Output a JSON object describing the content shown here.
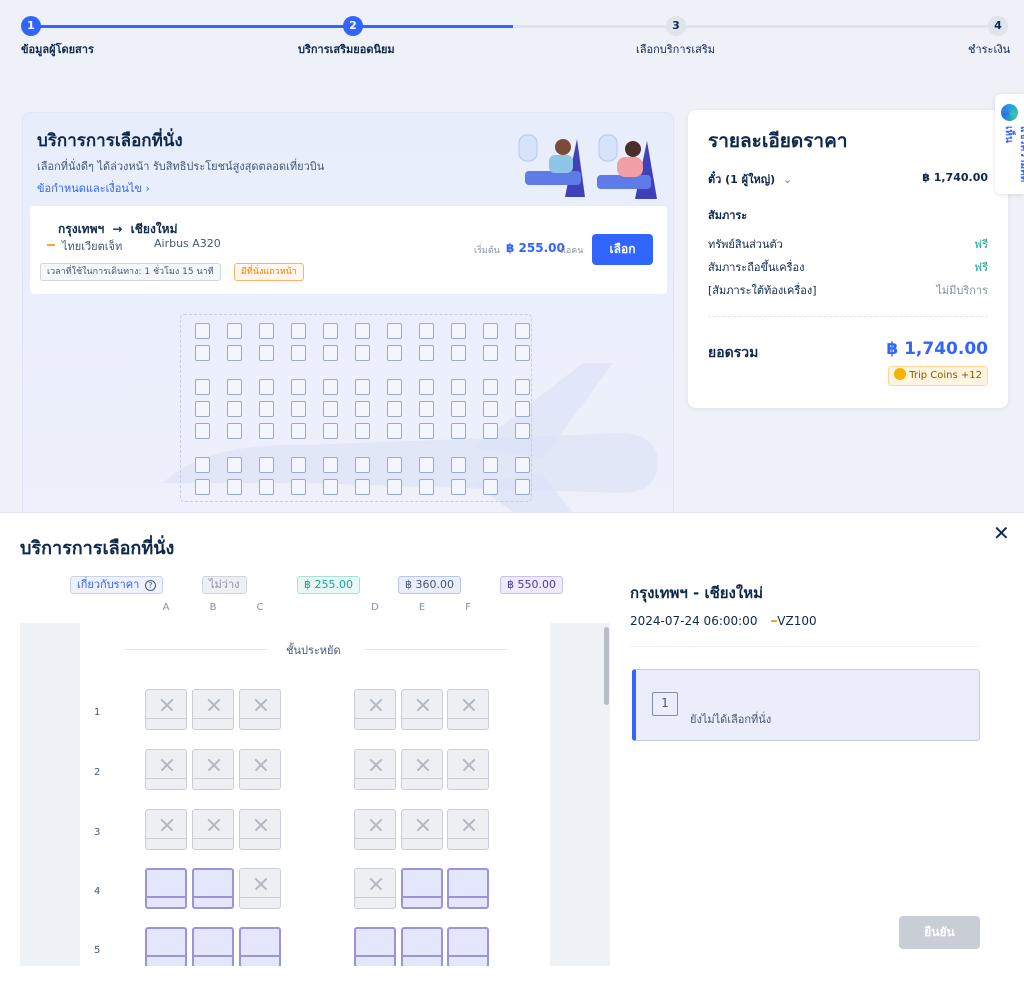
{
  "steps": [
    {
      "num": "1",
      "label": "ข้อมูลผู้โดยสาร"
    },
    {
      "num": "2",
      "label": "บริการเสริมยอดนิยม"
    },
    {
      "num": "3",
      "label": "เลือกบริการเสริม"
    },
    {
      "num": "4",
      "label": "ชำระเงิน"
    }
  ],
  "seat_card": {
    "title": "บริการการเลือกที่นั่ง",
    "subtitle": "เลือกที่นั่งดีๆ ได้ล่วงหน้า รับสิทธิประโยชน์สูงสุดตลอดเที่ยวบิน",
    "terms_link": "ข้อกำหนดและเงื่อนไข",
    "route_from": "กรุงเทพฯ",
    "route_to": "เชียงใหม่",
    "airline": "ไทยเวียตเจ็ท",
    "aircraft": "Airbus A320",
    "duration": "เวลาที่ใช้ในการเดินทาง: 1 ชั่วโมง 15 นาที",
    "front_row_badge": "มีที่นั่งแถวหน้า",
    "price_prefix": "เริ่มต้น",
    "price": "฿ 255.00",
    "price_suffix": "ต่อคน",
    "select_button": "เลือก"
  },
  "price_details": {
    "title": "รายละเอียดราคา",
    "ticket_label": "ตั๋ว (1 ผู้ใหญ่)",
    "ticket_price": "฿ 1,740.00",
    "baggage_heading": "สัมภาระ",
    "baggage_items": [
      {
        "label": "ทรัพย์สินส่วนตัว",
        "value": "ฟรี"
      },
      {
        "label": "สัมภาระถือขึ้นเครื่อง",
        "value": "ฟรี"
      },
      {
        "label": "[สัมภาระใต้ท้องเครื่อง]",
        "value": "ไม่มีบริการ"
      }
    ],
    "total_label": "ยอดรวม",
    "total_value": "฿ 1,740.00",
    "coins": "Trip Coins +12"
  },
  "side_tab": {
    "label": "แชร์ความคิดเห็น"
  },
  "modal": {
    "title": "บริการการเลือกที่นั่ง",
    "legend": {
      "about_price": "เกี่ยวกับราคา",
      "unavailable": "ไม่ว่าง",
      "price_green": "฿ 255.00",
      "price_blue": "฿ 360.00",
      "price_purple": "฿ 550.00"
    },
    "columns": [
      "A",
      "B",
      "C",
      "D",
      "E",
      "F"
    ],
    "cabin_label": "ชั้นประหยัด",
    "rows": [
      {
        "num": "1",
        "seats": [
          "x",
          "x",
          "x",
          "x",
          "x",
          "x"
        ]
      },
      {
        "num": "2",
        "seats": [
          "x",
          "x",
          "x",
          "x",
          "x",
          "x"
        ]
      },
      {
        "num": "3",
        "seats": [
          "x",
          "x",
          "x",
          "x",
          "x",
          "x"
        ]
      },
      {
        "num": "4",
        "seats": [
          "p",
          "p",
          "x",
          "x",
          "p",
          "p"
        ]
      },
      {
        "num": "5",
        "seats": [
          "p",
          "p",
          "p",
          "p",
          "p",
          "p"
        ]
      }
    ],
    "flight_route": "กรุงเทพฯ - เชียงใหม่",
    "flight_datetime": "2024-07-24 06:00:00",
    "flight_number": "VZ100",
    "passenger_num": "1",
    "no_seat_text": "ยังไม่ได้เลือกที่นั่ง",
    "confirm_button": "ยืนยัน"
  },
  "colors": {
    "accent": "#3264ff",
    "free": "#15a58f",
    "purple_seat": "#9b94d9"
  }
}
